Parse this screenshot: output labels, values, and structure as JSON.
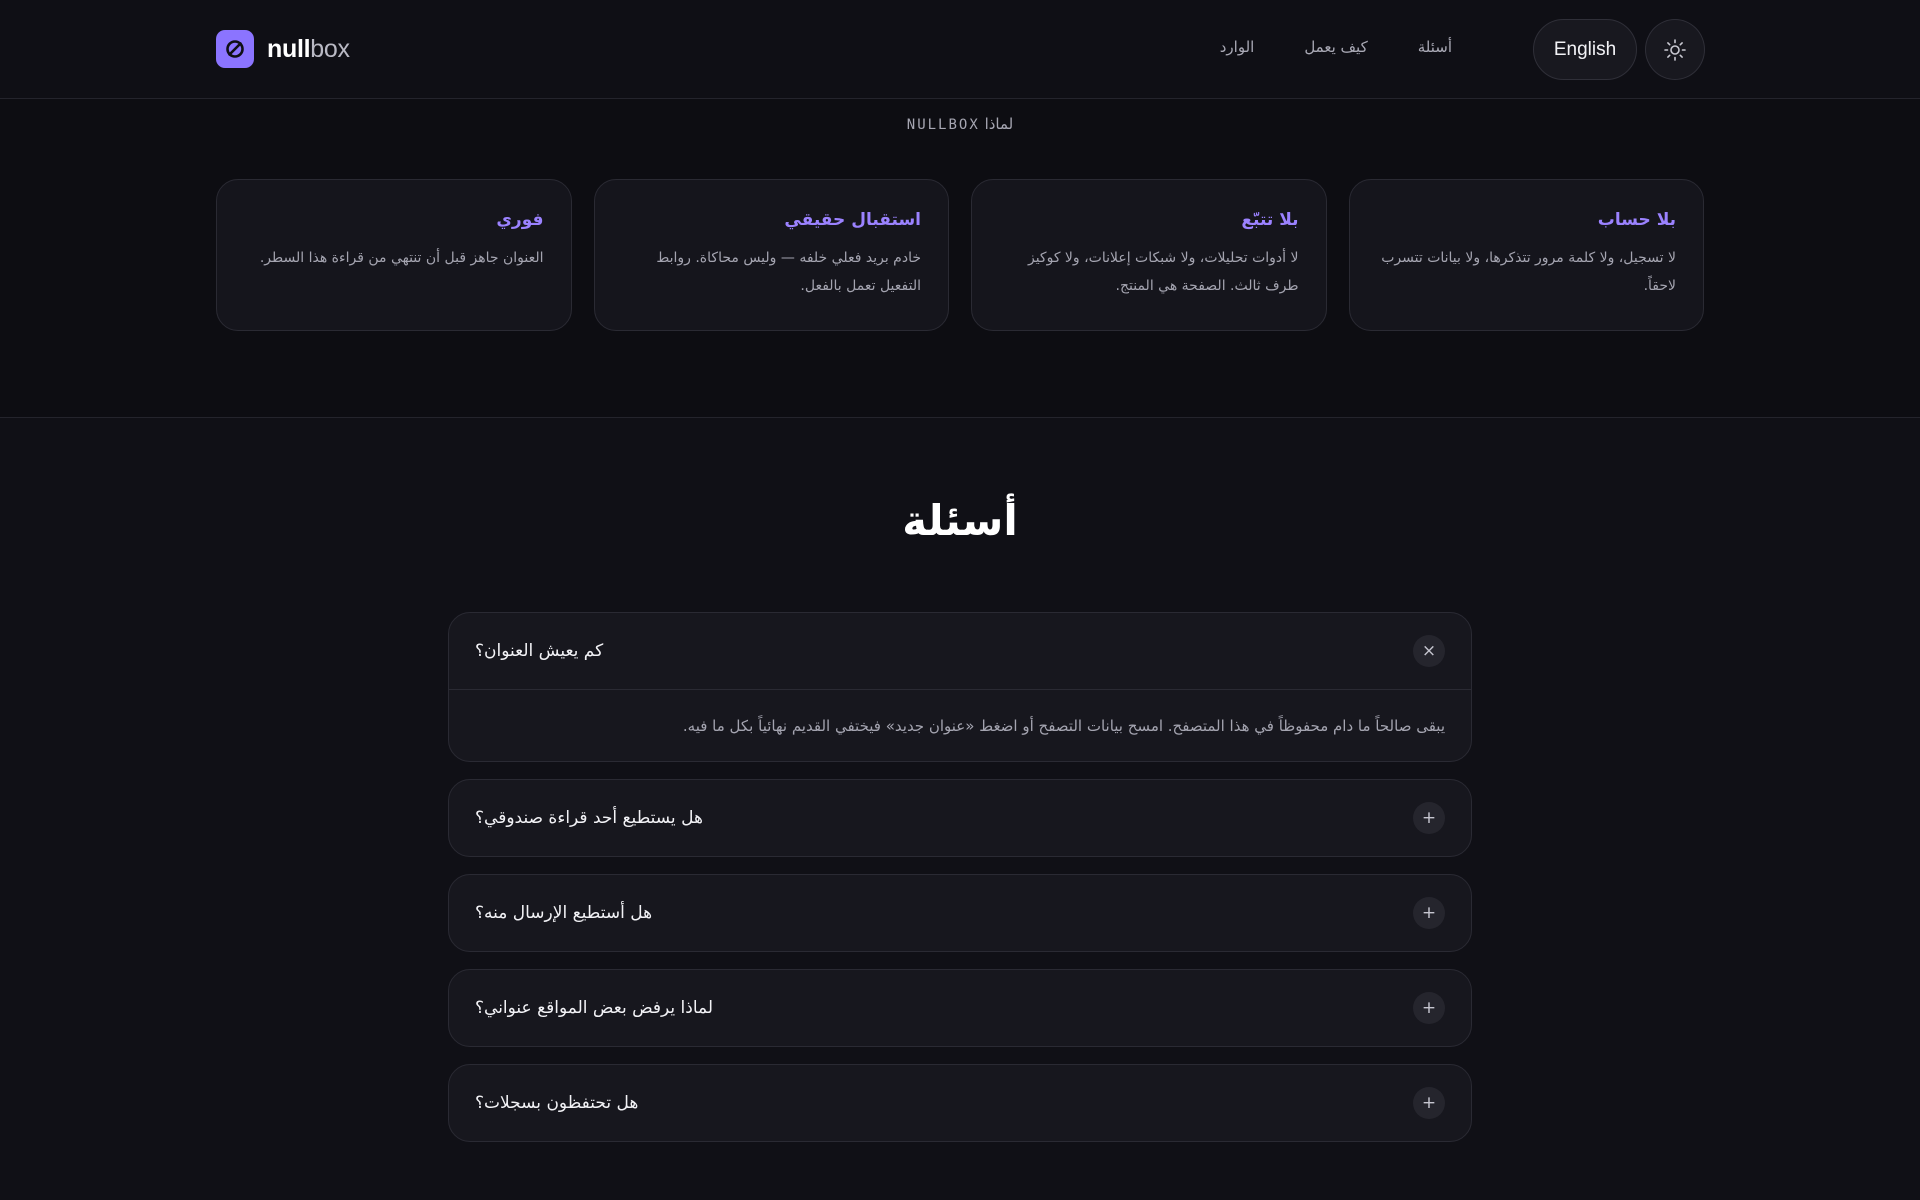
{
  "header": {
    "logo_bold": "null",
    "logo_light": "box",
    "nav": [
      "أسئلة",
      "كيف يعمل",
      "الوارد"
    ],
    "language_button": "English",
    "theme_icon": "sun-icon"
  },
  "why": {
    "eyebrow_word": "لماذا",
    "eyebrow_brand": "NULLBOX",
    "cards": [
      {
        "title": "بلا حساب",
        "body": "لا تسجيل، ولا كلمة مرور تتذكرها، ولا بيانات تتسرب لاحقاً."
      },
      {
        "title": "بلا تتبّع",
        "body": "لا أدوات تحليلات، ولا شبكات إعلانات، ولا كوكيز طرف ثالث. الصفحة هي المنتج."
      },
      {
        "title": "استقبال حقيقي",
        "body": "خادم بريد فعلي خلفه — وليس محاكاة. روابط التفعيل تعمل بالفعل."
      },
      {
        "title": "فوري",
        "body": "العنوان جاهز قبل أن تنتهي من قراءة هذا السطر."
      }
    ]
  },
  "faq": {
    "title": "أسئلة",
    "items": [
      {
        "question": "كم يعيش العنوان؟",
        "answer": "يبقى صالحاً ما دام محفوظاً في هذا المتصفح. امسح بيانات التصفح أو اضغط «عنوان جديد» فيختفي القديم نهائياً بكل ما فيه.",
        "open": true,
        "toggle": "×"
      },
      {
        "question": "هل يستطيع أحد قراءة صندوقي؟",
        "open": false,
        "toggle": "+"
      },
      {
        "question": "هل أستطيع الإرسال منه؟",
        "open": false,
        "toggle": "+"
      },
      {
        "question": "لماذا يرفض بعض المواقع عنواني؟",
        "open": false,
        "toggle": "+"
      },
      {
        "question": "هل تحتفظون بسجلات؟",
        "open": false,
        "toggle": "+"
      }
    ]
  },
  "colors": {
    "accent": "#8b74ff",
    "background": "#0d0d12",
    "card": "#15151c"
  }
}
